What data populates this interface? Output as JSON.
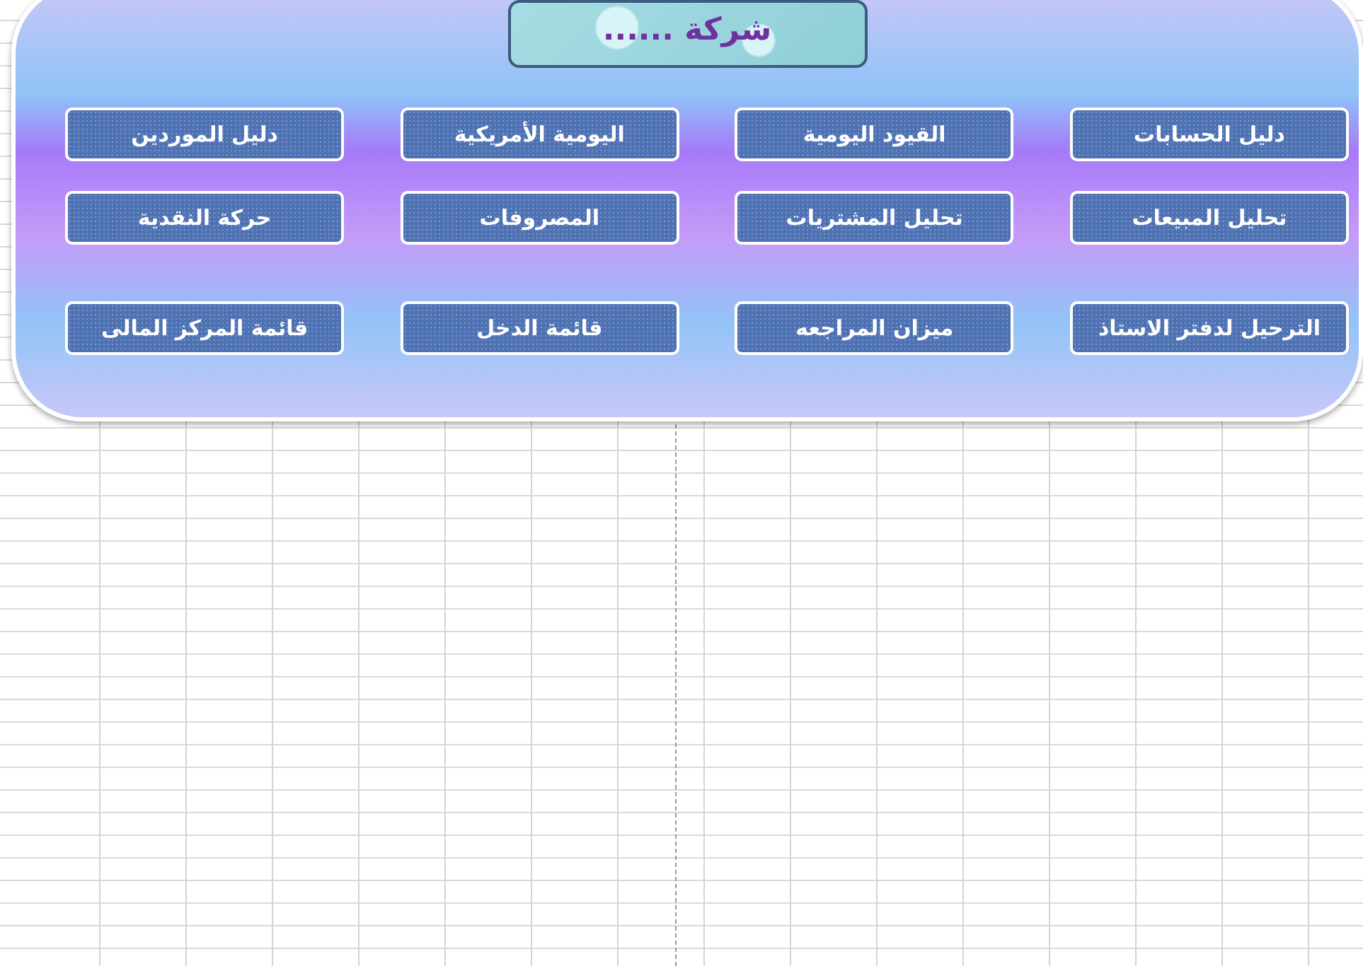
{
  "title": "شركة ......",
  "button_rows": [
    [
      "دليل الحسابات",
      "القيود اليومية",
      "اليومية الأمريكية",
      "دليل الموردين"
    ],
    [
      "تحليل المبيعات",
      "تحليل المشتريات",
      "المصروفات",
      "حركة النقدية"
    ],
    [
      "الترحيل لدفتر الاستاذ",
      "ميزان المراجعه",
      "قائمة الدخل",
      "قائمة المركز المالى"
    ]
  ]
}
